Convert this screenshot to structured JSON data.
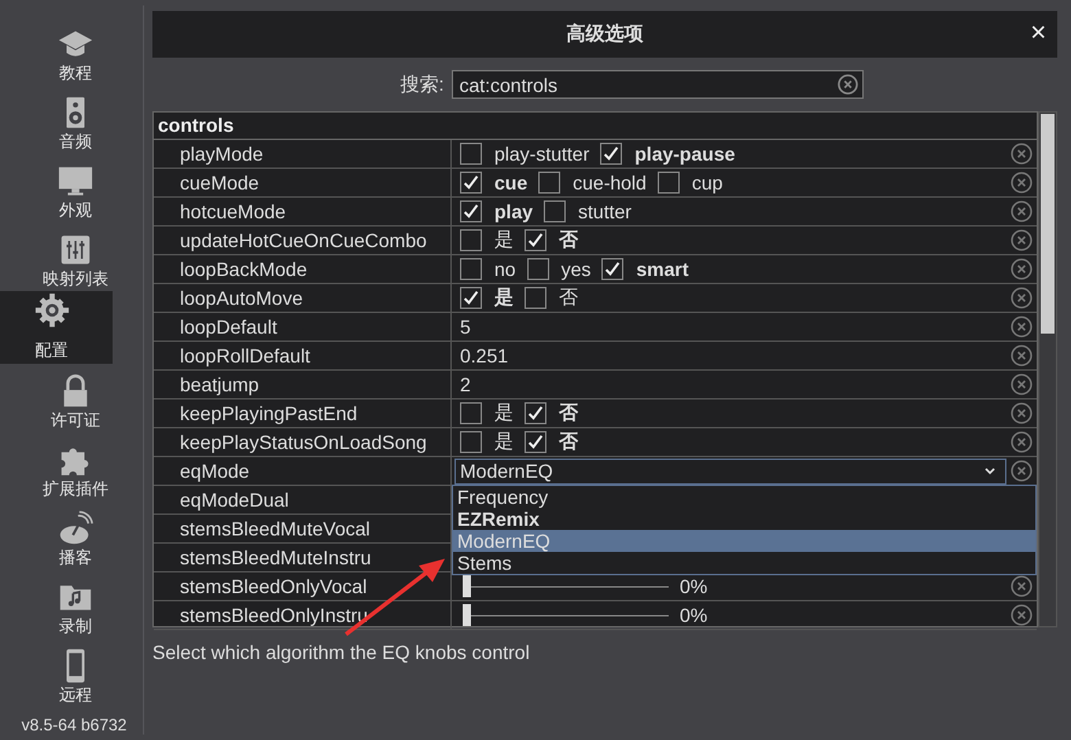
{
  "sidebar": {
    "items": [
      {
        "label": "教程",
        "selected": false
      },
      {
        "label": "音频",
        "selected": false
      },
      {
        "label": "外观",
        "selected": false
      },
      {
        "label": "映射列表",
        "selected": false
      },
      {
        "label": "配置",
        "selected": true
      },
      {
        "label": "许可证",
        "selected": false
      },
      {
        "label": "扩展插件",
        "selected": false
      },
      {
        "label": "播客",
        "selected": false
      },
      {
        "label": "录制",
        "selected": false
      },
      {
        "label": "远程",
        "selected": false
      }
    ],
    "version": "v8.5-64 b6732"
  },
  "window": {
    "title": "高级选项",
    "close": "×"
  },
  "search": {
    "label": "搜索:",
    "value": "cat:controls"
  },
  "table": {
    "group": "controls",
    "rows": [
      {
        "name": "playMode",
        "kind": "options",
        "options": [
          {
            "label": "play-stutter",
            "checked": false
          },
          {
            "label": "play-pause",
            "checked": true
          }
        ]
      },
      {
        "name": "cueMode",
        "kind": "options",
        "options": [
          {
            "label": "cue",
            "checked": true
          },
          {
            "label": "cue-hold",
            "checked": false
          },
          {
            "label": "cup",
            "checked": false
          }
        ]
      },
      {
        "name": "hotcueMode",
        "kind": "options",
        "options": [
          {
            "label": "play",
            "checked": true
          },
          {
            "label": "stutter",
            "checked": false
          }
        ]
      },
      {
        "name": "updateHotCueOnCueCombo",
        "kind": "options",
        "options": [
          {
            "label": "是",
            "checked": false
          },
          {
            "label": "否",
            "checked": true
          }
        ]
      },
      {
        "name": "loopBackMode",
        "kind": "options",
        "options": [
          {
            "label": "no",
            "checked": false
          },
          {
            "label": "yes",
            "checked": false
          },
          {
            "label": "smart",
            "checked": true
          }
        ]
      },
      {
        "name": "loopAutoMove",
        "kind": "options",
        "options": [
          {
            "label": "是",
            "checked": true
          },
          {
            "label": "否",
            "checked": false
          }
        ]
      },
      {
        "name": "loopDefault",
        "kind": "text",
        "value": "5"
      },
      {
        "name": "loopRollDefault",
        "kind": "text",
        "value": "0.251"
      },
      {
        "name": "beatjump",
        "kind": "text",
        "value": "2"
      },
      {
        "name": "keepPlayingPastEnd",
        "kind": "options",
        "options": [
          {
            "label": "是",
            "checked": false
          },
          {
            "label": "否",
            "checked": true
          }
        ]
      },
      {
        "name": "keepPlayStatusOnLoadSong",
        "kind": "options",
        "options": [
          {
            "label": "是",
            "checked": false
          },
          {
            "label": "否",
            "checked": true
          }
        ]
      },
      {
        "name": "eqMode",
        "kind": "select",
        "value": "ModernEQ",
        "expanded": true,
        "choices": [
          {
            "label": "Frequency",
            "selected": false,
            "bold": false
          },
          {
            "label": "EZRemix",
            "selected": false,
            "bold": true
          },
          {
            "label": "ModernEQ",
            "selected": true,
            "bold": false
          },
          {
            "label": "Stems",
            "selected": false,
            "bold": false
          }
        ]
      },
      {
        "name": "eqModeDual",
        "kind": "covered"
      },
      {
        "name": "stemsBleedMuteVocal",
        "kind": "covered"
      },
      {
        "name": "stemsBleedMuteInstru",
        "kind": "covered"
      },
      {
        "name": "stemsBleedOnlyVocal",
        "kind": "slider",
        "level": 0,
        "reading": "0%"
      },
      {
        "name": "stemsBleedOnlyInstru",
        "kind": "slider",
        "level": 0,
        "reading": "0%"
      }
    ]
  },
  "help": "Select which algorithm the EQ knobs control"
}
